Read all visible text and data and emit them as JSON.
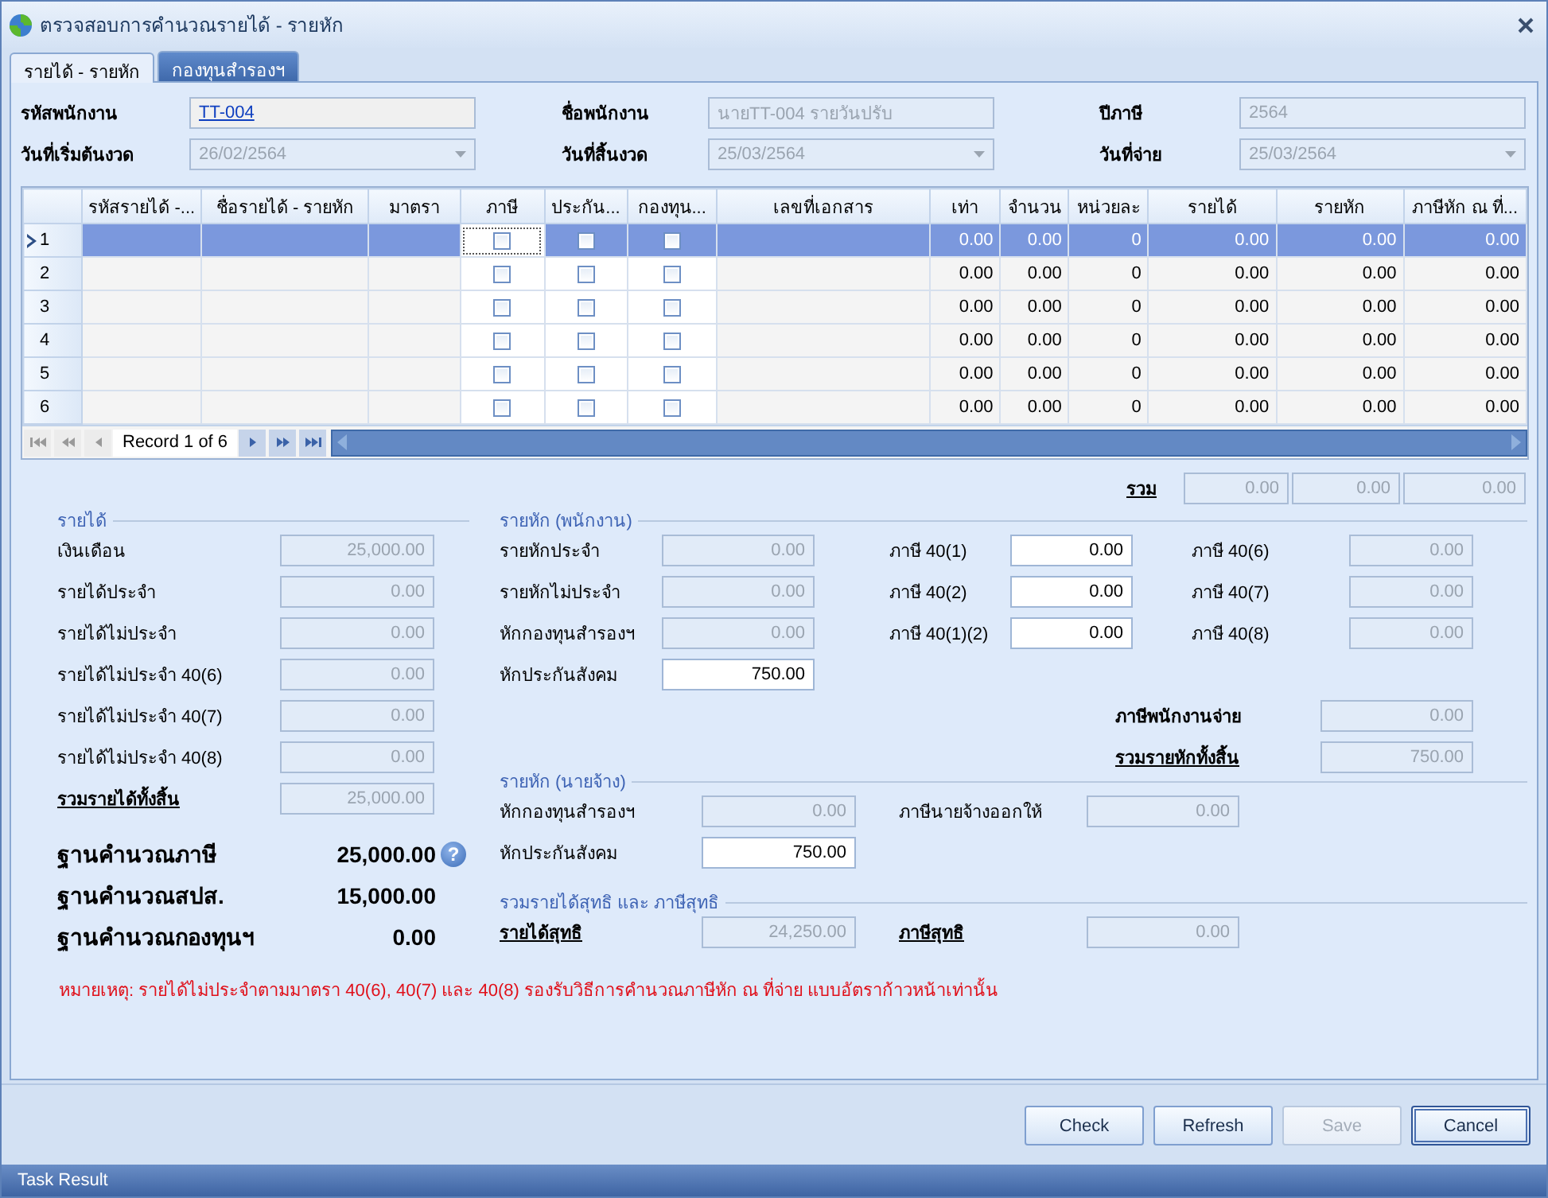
{
  "window": {
    "title": "ตรวจสอบการคำนวณรายได้ - รายหัก"
  },
  "tabs": [
    {
      "label": "รายได้ - รายหัก",
      "selected": true
    },
    {
      "label": "กองทุนสำรองฯ",
      "selected": false
    }
  ],
  "header_fields": [
    {
      "label": "รหัสพนักงาน",
      "value": "TT-004",
      "kind": "link"
    },
    {
      "label": "ชื่อพนักงาน",
      "value": "นายTT-004 รายวันปรับ",
      "kind": "readonly"
    },
    {
      "label": "ปีภาษี",
      "value": "2564",
      "kind": "readonly"
    },
    {
      "label": "วันที่เริ่มต้นงวด",
      "value": "26/02/2564",
      "kind": "combo"
    },
    {
      "label": "วันที่สิ้นงวด",
      "value": "25/03/2564",
      "kind": "combo"
    },
    {
      "label": "วันที่จ่าย",
      "value": "25/03/2564",
      "kind": "combo"
    }
  ],
  "grid": {
    "columns": [
      "รหัสรายได้ -...",
      "ชื่อรายได้ - รายหัก",
      "มาตรา",
      "ภาษี",
      "ประกัน...",
      "กองทุน...",
      "เลขที่เอกสาร",
      "เท่า",
      "จำนวน",
      "หน่วยละ",
      "รายได้",
      "รายหัก",
      "ภาษีหัก ณ ที่..."
    ],
    "rows": [
      {
        "row_header": "1",
        "selected": true,
        "cells": [
          {
            "kind": "blank"
          },
          {
            "kind": "blank"
          },
          {
            "kind": "blank"
          },
          {
            "kind": "check",
            "checked": false,
            "focused": true
          },
          {
            "kind": "check",
            "checked": false,
            "focused": false
          },
          {
            "kind": "check",
            "checked": false,
            "focused": false
          },
          {
            "kind": "blank"
          },
          {
            "kind": "number",
            "text": "0.00"
          },
          {
            "kind": "number",
            "text": "0.00"
          },
          {
            "kind": "number",
            "text": "0"
          },
          {
            "kind": "number",
            "text": "0.00"
          },
          {
            "kind": "number",
            "text": "0.00"
          },
          {
            "kind": "number",
            "text": "0.00"
          }
        ]
      },
      {
        "row_header": "2",
        "selected": false,
        "cells": [
          {
            "kind": "blank"
          },
          {
            "kind": "blank"
          },
          {
            "kind": "blank"
          },
          {
            "kind": "check",
            "checked": false,
            "focused": false
          },
          {
            "kind": "check",
            "checked": false,
            "focused": false
          },
          {
            "kind": "check",
            "checked": false,
            "focused": false
          },
          {
            "kind": "blank"
          },
          {
            "kind": "number",
            "text": "0.00"
          },
          {
            "kind": "number",
            "text": "0.00"
          },
          {
            "kind": "number",
            "text": "0"
          },
          {
            "kind": "number",
            "text": "0.00"
          },
          {
            "kind": "number",
            "text": "0.00"
          },
          {
            "kind": "number",
            "text": "0.00"
          }
        ]
      },
      {
        "row_header": "3",
        "selected": false,
        "cells": [
          {
            "kind": "blank"
          },
          {
            "kind": "blank"
          },
          {
            "kind": "blank"
          },
          {
            "kind": "check",
            "checked": false,
            "focused": false
          },
          {
            "kind": "check",
            "checked": false,
            "focused": false
          },
          {
            "kind": "check",
            "checked": false,
            "focused": false
          },
          {
            "kind": "blank"
          },
          {
            "kind": "number",
            "text": "0.00"
          },
          {
            "kind": "number",
            "text": "0.00"
          },
          {
            "kind": "number",
            "text": "0"
          },
          {
            "kind": "number",
            "text": "0.00"
          },
          {
            "kind": "number",
            "text": "0.00"
          },
          {
            "kind": "number",
            "text": "0.00"
          }
        ]
      },
      {
        "row_header": "4",
        "selected": false,
        "cells": [
          {
            "kind": "blank"
          },
          {
            "kind": "blank"
          },
          {
            "kind": "blank"
          },
          {
            "kind": "check",
            "checked": false,
            "focused": false
          },
          {
            "kind": "check",
            "checked": false,
            "focused": false
          },
          {
            "kind": "check",
            "checked": false,
            "focused": false
          },
          {
            "kind": "blank"
          },
          {
            "kind": "number",
            "text": "0.00"
          },
          {
            "kind": "number",
            "text": "0.00"
          },
          {
            "kind": "number",
            "text": "0"
          },
          {
            "kind": "number",
            "text": "0.00"
          },
          {
            "kind": "number",
            "text": "0.00"
          },
          {
            "kind": "number",
            "text": "0.00"
          }
        ]
      },
      {
        "row_header": "5",
        "selected": false,
        "cells": [
          {
            "kind": "blank"
          },
          {
            "kind": "blank"
          },
          {
            "kind": "blank"
          },
          {
            "kind": "check",
            "checked": false,
            "focused": false
          },
          {
            "kind": "check",
            "checked": false,
            "focused": false
          },
          {
            "kind": "check",
            "checked": false,
            "focused": false
          },
          {
            "kind": "blank"
          },
          {
            "kind": "number",
            "text": "0.00"
          },
          {
            "kind": "number",
            "text": "0.00"
          },
          {
            "kind": "number",
            "text": "0"
          },
          {
            "kind": "number",
            "text": "0.00"
          },
          {
            "kind": "number",
            "text": "0.00"
          },
          {
            "kind": "number",
            "text": "0.00"
          }
        ]
      },
      {
        "row_header": "6",
        "selected": false,
        "cells": [
          {
            "kind": "blank"
          },
          {
            "kind": "blank"
          },
          {
            "kind": "blank"
          },
          {
            "kind": "check",
            "checked": false,
            "focused": false
          },
          {
            "kind": "check",
            "checked": false,
            "focused": false
          },
          {
            "kind": "check",
            "checked": false,
            "focused": false
          },
          {
            "kind": "blank"
          },
          {
            "kind": "number",
            "text": "0.00"
          },
          {
            "kind": "number",
            "text": "0.00"
          },
          {
            "kind": "number",
            "text": "0"
          },
          {
            "kind": "number",
            "text": "0.00"
          },
          {
            "kind": "number",
            "text": "0.00"
          },
          {
            "kind": "number",
            "text": "0.00"
          }
        ]
      }
    ],
    "navigator": {
      "record_text": "Record 1 of 6",
      "buttons": [
        {
          "kind": "first",
          "disabled": true
        },
        {
          "kind": "prev_page",
          "disabled": true
        },
        {
          "kind": "prev",
          "disabled": true
        },
        {
          "kind": "next",
          "disabled": false
        },
        {
          "kind": "next_page",
          "disabled": false
        },
        {
          "kind": "last",
          "disabled": false
        }
      ]
    }
  },
  "totals": {
    "label": "รวม",
    "values": [
      "0.00",
      "0.00",
      "0.00"
    ]
  },
  "income": {
    "title": "รายได้",
    "rows": [
      {
        "label": "เงินเดือน",
        "value": "25,000.00",
        "kind": "plain"
      },
      {
        "label": "รายได้ประจำ",
        "value": "0.00",
        "kind": "plain"
      },
      {
        "label": "รายได้ไม่ประจำ",
        "value": "0.00",
        "kind": "plain"
      },
      {
        "label": "รายได้ไม่ประจำ 40(6)",
        "value": "0.00",
        "kind": "plain"
      },
      {
        "label": "รายได้ไม่ประจำ 40(7)",
        "value": "0.00",
        "kind": "plain"
      },
      {
        "label": "รายได้ไม่ประจำ 40(8)",
        "value": "0.00",
        "kind": "plain"
      },
      {
        "label": "รวมรายได้ทั้งสิ้น",
        "value": "25,000.00",
        "kind": "total"
      }
    ]
  },
  "bases": [
    {
      "label": "ฐานคำนวณภาษี",
      "value": "25,000.00",
      "help": "?"
    },
    {
      "label": "ฐานคำนวณสปส.",
      "value": "15,000.00"
    },
    {
      "label": "ฐานคำนวณกองทุนฯ",
      "value": "0.00"
    }
  ],
  "employee_deductions": {
    "title": "รายหัก (พนักงาน)",
    "rows": [
      [
        {
          "label": "รายหักประจำ",
          "value": "0.00",
          "editable": false
        },
        {
          "label": "ภาษี 40(1)",
          "value": "0.00",
          "editable": true
        },
        {
          "label": "ภาษี 40(6)",
          "value": "0.00",
          "editable": false
        }
      ],
      [
        {
          "label": "รายหักไม่ประจำ",
          "value": "0.00",
          "editable": false
        },
        {
          "label": "ภาษี 40(2)",
          "value": "0.00",
          "editable": true
        },
        {
          "label": "ภาษี 40(7)",
          "value": "0.00",
          "editable": false
        }
      ],
      [
        {
          "label": "หักกองทุนสำรองฯ",
          "value": "0.00",
          "editable": false
        },
        {
          "label": "ภาษี 40(1)(2)",
          "value": "0.00",
          "editable": true
        },
        {
          "label": "ภาษี 40(8)",
          "value": "0.00",
          "editable": false
        }
      ],
      [
        {
          "label": "หักประกันสังคม",
          "value": "750.00",
          "editable": true
        }
      ]
    ],
    "summary": [
      {
        "label": "ภาษีพนักงานจ่าย",
        "value": "0.00",
        "editable": false,
        "kind": "bold"
      },
      {
        "label": "รวมรายหักทั้งสิ้น",
        "value": "750.00",
        "editable": false,
        "kind": "total"
      }
    ]
  },
  "employer_deductions": {
    "title": "รายหัก (นายจ้าง)",
    "rows": [
      [
        {
          "label": "หักกองทุนสำรองฯ",
          "value": "0.00",
          "editable": false
        },
        {
          "label": "ภาษีนายจ้างออกให้",
          "value": "0.00",
          "editable": false
        }
      ],
      [
        {
          "label": "หักประกันสังคม",
          "value": "750.00",
          "editable": true
        }
      ]
    ]
  },
  "net": {
    "title": "รวมรายได้สุทธิ และ ภาษีสุทธิ",
    "rows": [
      [
        {
          "label": "รายได้สุทธิ",
          "value": "24,250.00",
          "editable": false,
          "kind": "total"
        },
        {
          "label": "ภาษีสุทธิ",
          "value": "0.00",
          "editable": false,
          "kind": "total"
        }
      ]
    ]
  },
  "note": "หมายเหตุ: รายได้ไม่ประจำตามมาตรา 40(6), 40(7) และ 40(8)  รองรับวิธีการคำนวณภาษีหัก ณ ที่จ่าย แบบอัตราก้าวหน้าเท่านั้น",
  "buttons": [
    {
      "label": "Check",
      "disabled": false,
      "focused": false
    },
    {
      "label": "Refresh",
      "disabled": false,
      "focused": false
    },
    {
      "label": "Save",
      "disabled": true,
      "focused": false
    },
    {
      "label": "Cancel",
      "disabled": false,
      "focused": true
    }
  ],
  "status_bar": {
    "text": "Task Result"
  }
}
